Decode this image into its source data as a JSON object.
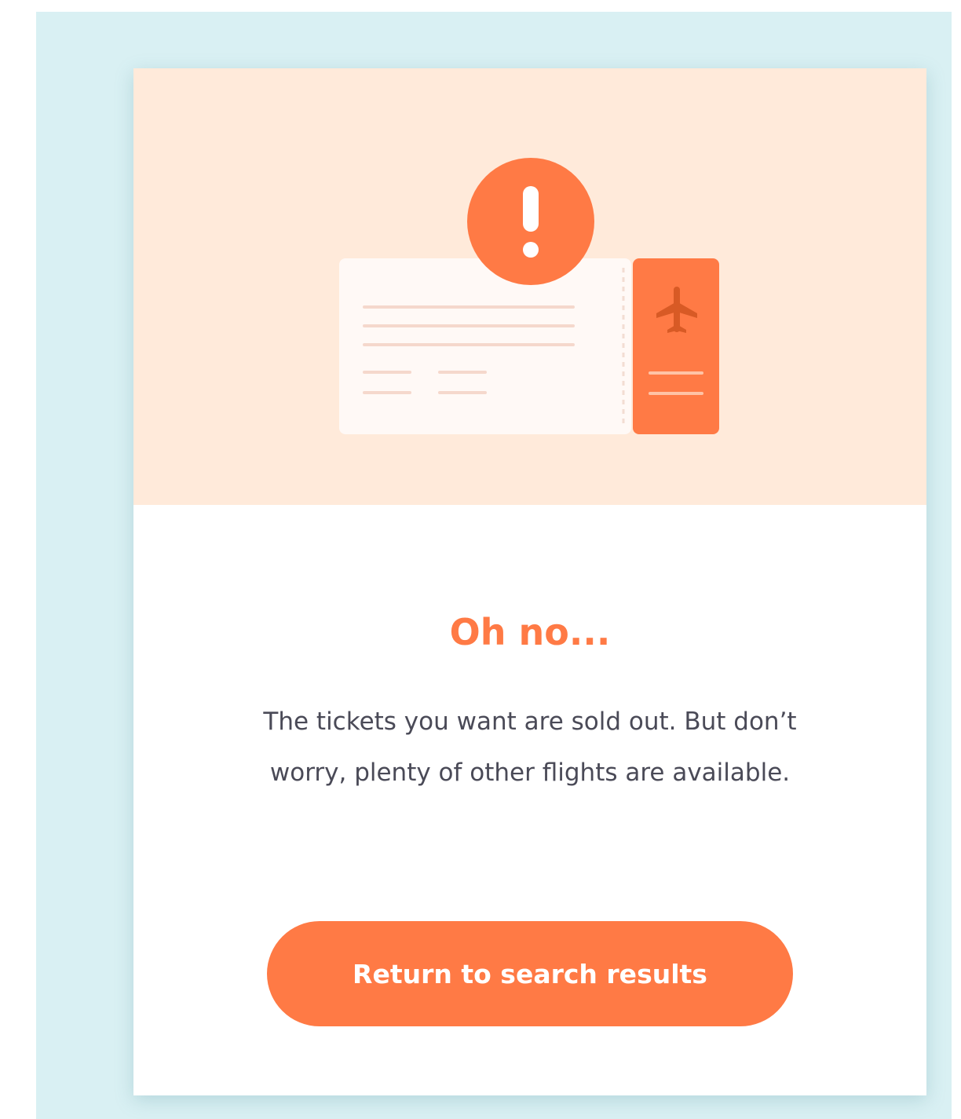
{
  "dialog": {
    "title": "Oh no...",
    "message": "The tickets you want are sold out. But don’t worry, plenty of other flights are available.",
    "button_label": "Return to search results"
  },
  "illustration": {
    "icons": [
      "alert-icon",
      "airplane-icon"
    ]
  },
  "colors": {
    "accent": "#ff7a45",
    "hero_background": "#ffeada",
    "page_background": "#d9f0f3",
    "card_background": "#ffffff",
    "body_text": "#4a4a57"
  }
}
